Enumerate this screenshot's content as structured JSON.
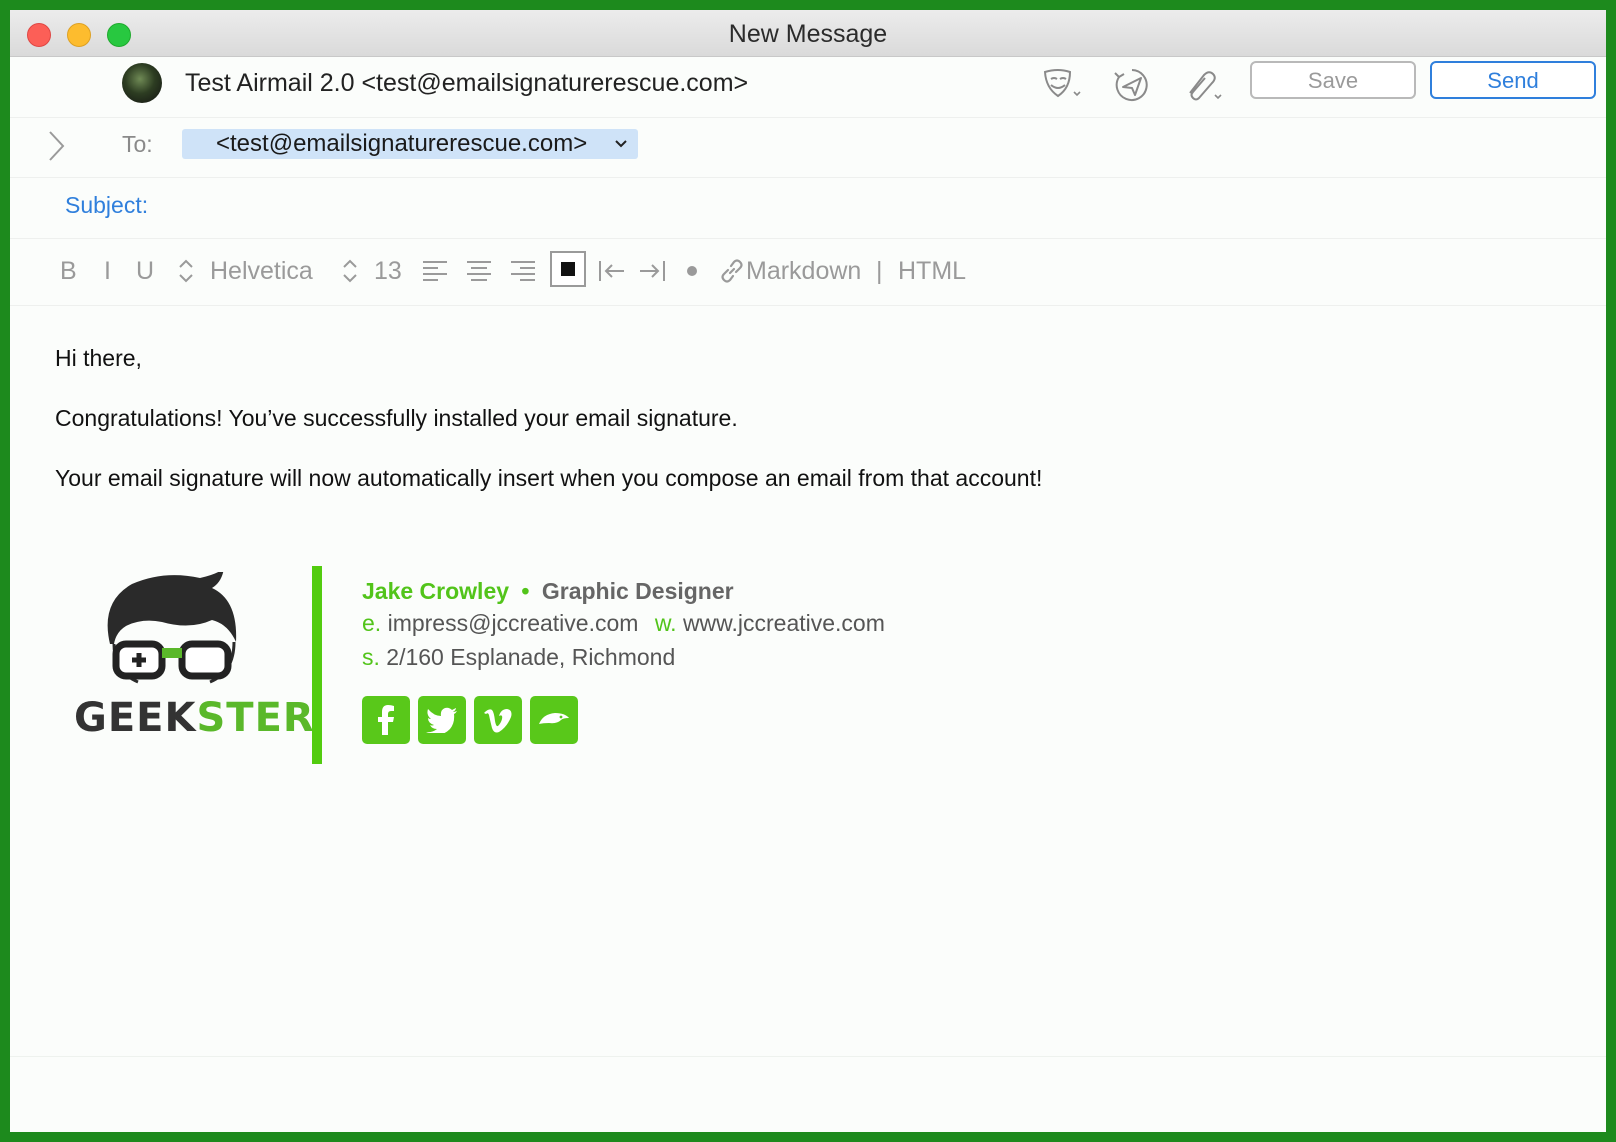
{
  "window": {
    "title": "New Message"
  },
  "compose": {
    "from": "Test Airmail 2.0 <test@emailsignaturerescue.com>",
    "to_label": "To:",
    "to_recipient": "<test@emailsignaturerescue.com>",
    "subject_label": "Subject:",
    "subject_value": ""
  },
  "toolbar": {
    "save_label": "Save",
    "send_label": "Send",
    "icons": [
      "mask-icon",
      "send-later-icon",
      "attachment-icon"
    ]
  },
  "format": {
    "bold": "B",
    "italic": "I",
    "underline": "U",
    "font": "Helvetica",
    "size": "13",
    "markdown": "Markdown",
    "separator": "|",
    "html": "HTML"
  },
  "message": {
    "line1": "Hi there,",
    "line2": "Congratulations! You’ve successfully installed your email signature.",
    "line3": "Your email signature will now automatically insert when you compose an email from that account!"
  },
  "signature": {
    "logo_text_1": "GEEK",
    "logo_text_2": "STER",
    "name": "Jake Crowley",
    "bullet": "•",
    "title": "Graphic Designer",
    "email_prefix": "e.",
    "email": "impress@jccreative.com",
    "web_prefix": "w.",
    "web": "www.jccreative.com",
    "address_prefix": "s.",
    "address": "2/160 Esplanade, Richmond",
    "social": [
      "facebook-icon",
      "twitter-icon",
      "vimeo-icon",
      "grooveshark-icon"
    ],
    "accent_color": "#52cc0f"
  },
  "colors": {
    "send_blue": "#2f7fdc",
    "border_green": "#1d8a1d"
  }
}
